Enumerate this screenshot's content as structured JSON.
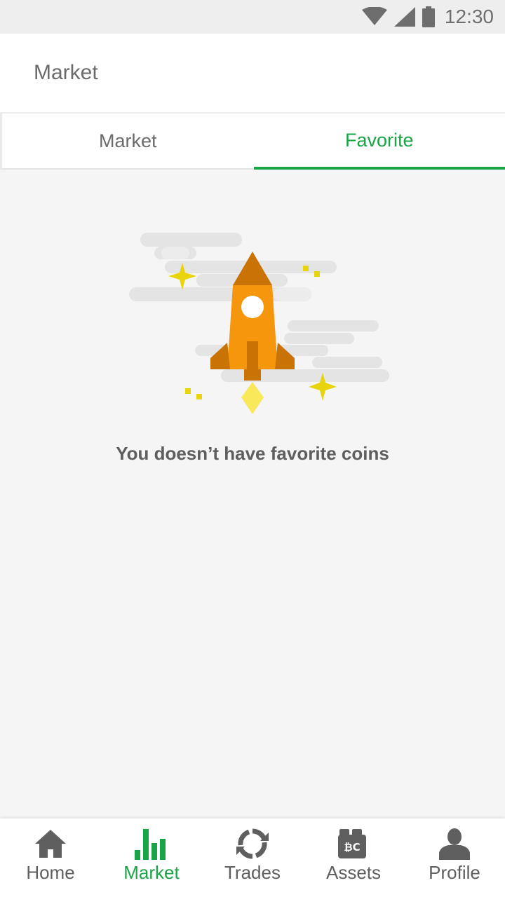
{
  "status_bar": {
    "time": "12:30"
  },
  "app_bar": {
    "title": "Market"
  },
  "tabs": [
    {
      "label": "Market",
      "active": false
    },
    {
      "label": "Favorite",
      "active": true
    }
  ],
  "empty_state": {
    "message": "You doesn’t have favorite coins",
    "illustration": "rocket-illustration"
  },
  "bottom_nav": [
    {
      "label": "Home",
      "icon": "home-icon",
      "active": false
    },
    {
      "label": "Market",
      "icon": "bar-chart-icon",
      "active": true
    },
    {
      "label": "Trades",
      "icon": "sync-icon",
      "active": false
    },
    {
      "label": "Assets",
      "icon": "wallet-icon",
      "active": false
    },
    {
      "label": "Profile",
      "icon": "person-icon",
      "active": false
    }
  ],
  "colors": {
    "accent": "#19a547",
    "rocket": "#f5960c",
    "rocket_dark": "#c97306",
    "star": "#e8d40a",
    "flame": "#f8e85a"
  }
}
